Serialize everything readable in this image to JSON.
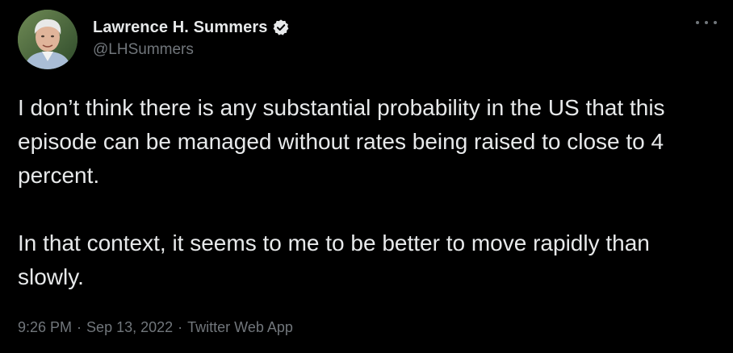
{
  "author": {
    "name": "Lawrence H. Summers",
    "handle": "@LHSummers",
    "verified_icon": "verified-badge-icon"
  },
  "menu": {
    "icon": "more-options-icon"
  },
  "tweet": {
    "paragraphs": [
      "I don’t think there is any substantial probability in the US that this episode can be managed without rates being raised to close to 4 percent.",
      "In that context, it seems to me to be better to move rapidly than slowly."
    ],
    "time": "9:26 PM",
    "date": "Sep 13, 2022",
    "source": "Twitter Web App",
    "separator": "·"
  },
  "colors": {
    "background": "#000000",
    "text": "#e7e9ea",
    "secondary_text": "#71767b"
  }
}
